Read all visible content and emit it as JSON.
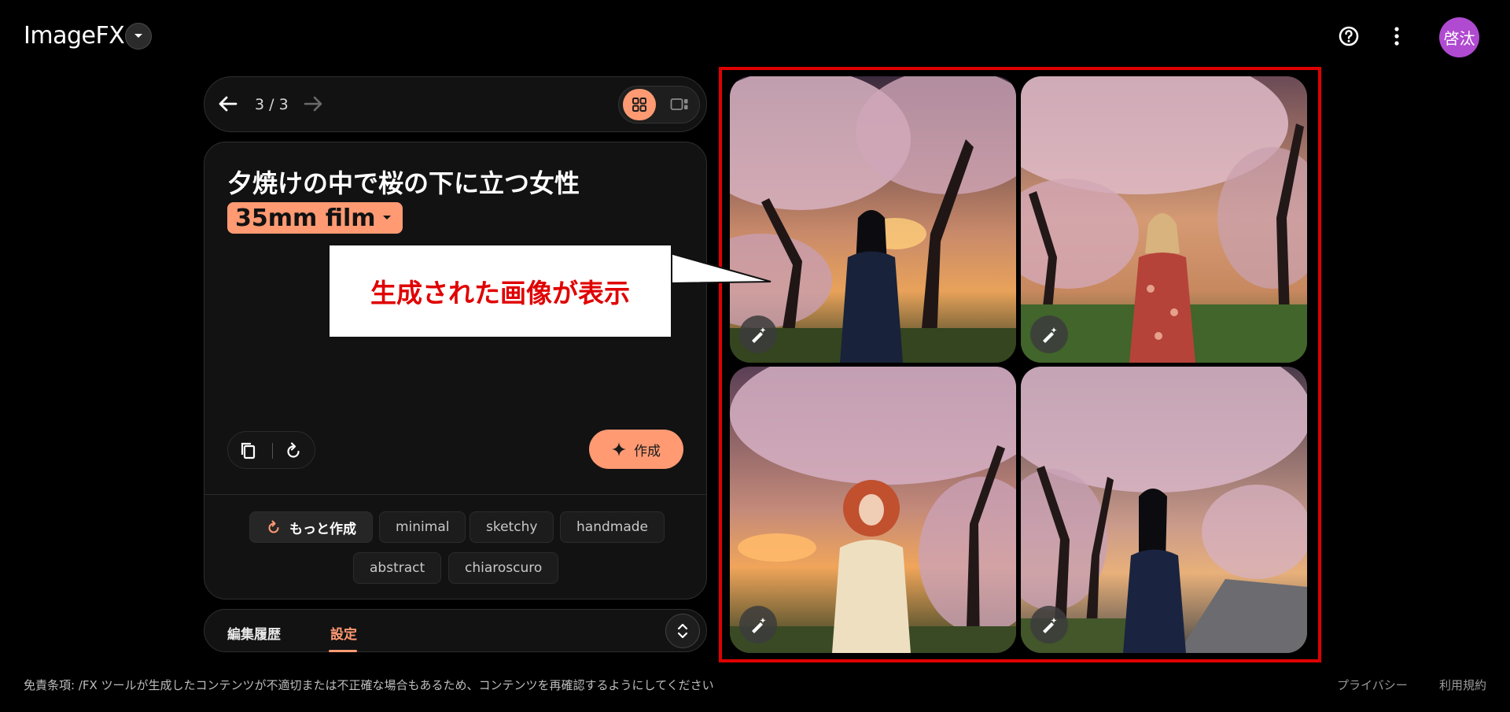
{
  "app": {
    "name": "ImageFX"
  },
  "header": {
    "avatar_initials": "啓汰"
  },
  "nav": {
    "counter": "3 / 3"
  },
  "prompt": {
    "text": "夕焼けの中で桜の下に立つ女性",
    "style_chip": "35mm film",
    "create_label": "作成"
  },
  "suggestions": {
    "more_label": "もっと作成",
    "chips": [
      "minimal",
      "sketchy",
      "handmade",
      "abstract",
      "chiaroscuro"
    ]
  },
  "tabs": {
    "history": "編集履歴",
    "settings": "設定"
  },
  "annotation": {
    "text": "生成された画像が表示"
  },
  "footer": {
    "disclaimer": "免責条項: /FX ツールが生成したコンテンツが不適切または不正確な場合もあるため、コンテンツを再確認するようにしてください",
    "privacy": "プライバシー",
    "terms": "利用規約"
  },
  "colors": {
    "accent": "#ff9a73",
    "highlight": "#e00000",
    "avatar": "#b04ad1"
  },
  "images": [
    {
      "name": "generated-image-1",
      "subject": "woman-dark-hair-navy-dress"
    },
    {
      "name": "generated-image-2",
      "subject": "woman-blonde-floral-dress"
    },
    {
      "name": "generated-image-3",
      "subject": "woman-red-curly-hair-cream-dress"
    },
    {
      "name": "generated-image-4",
      "subject": "woman-dark-hair-profile"
    }
  ]
}
